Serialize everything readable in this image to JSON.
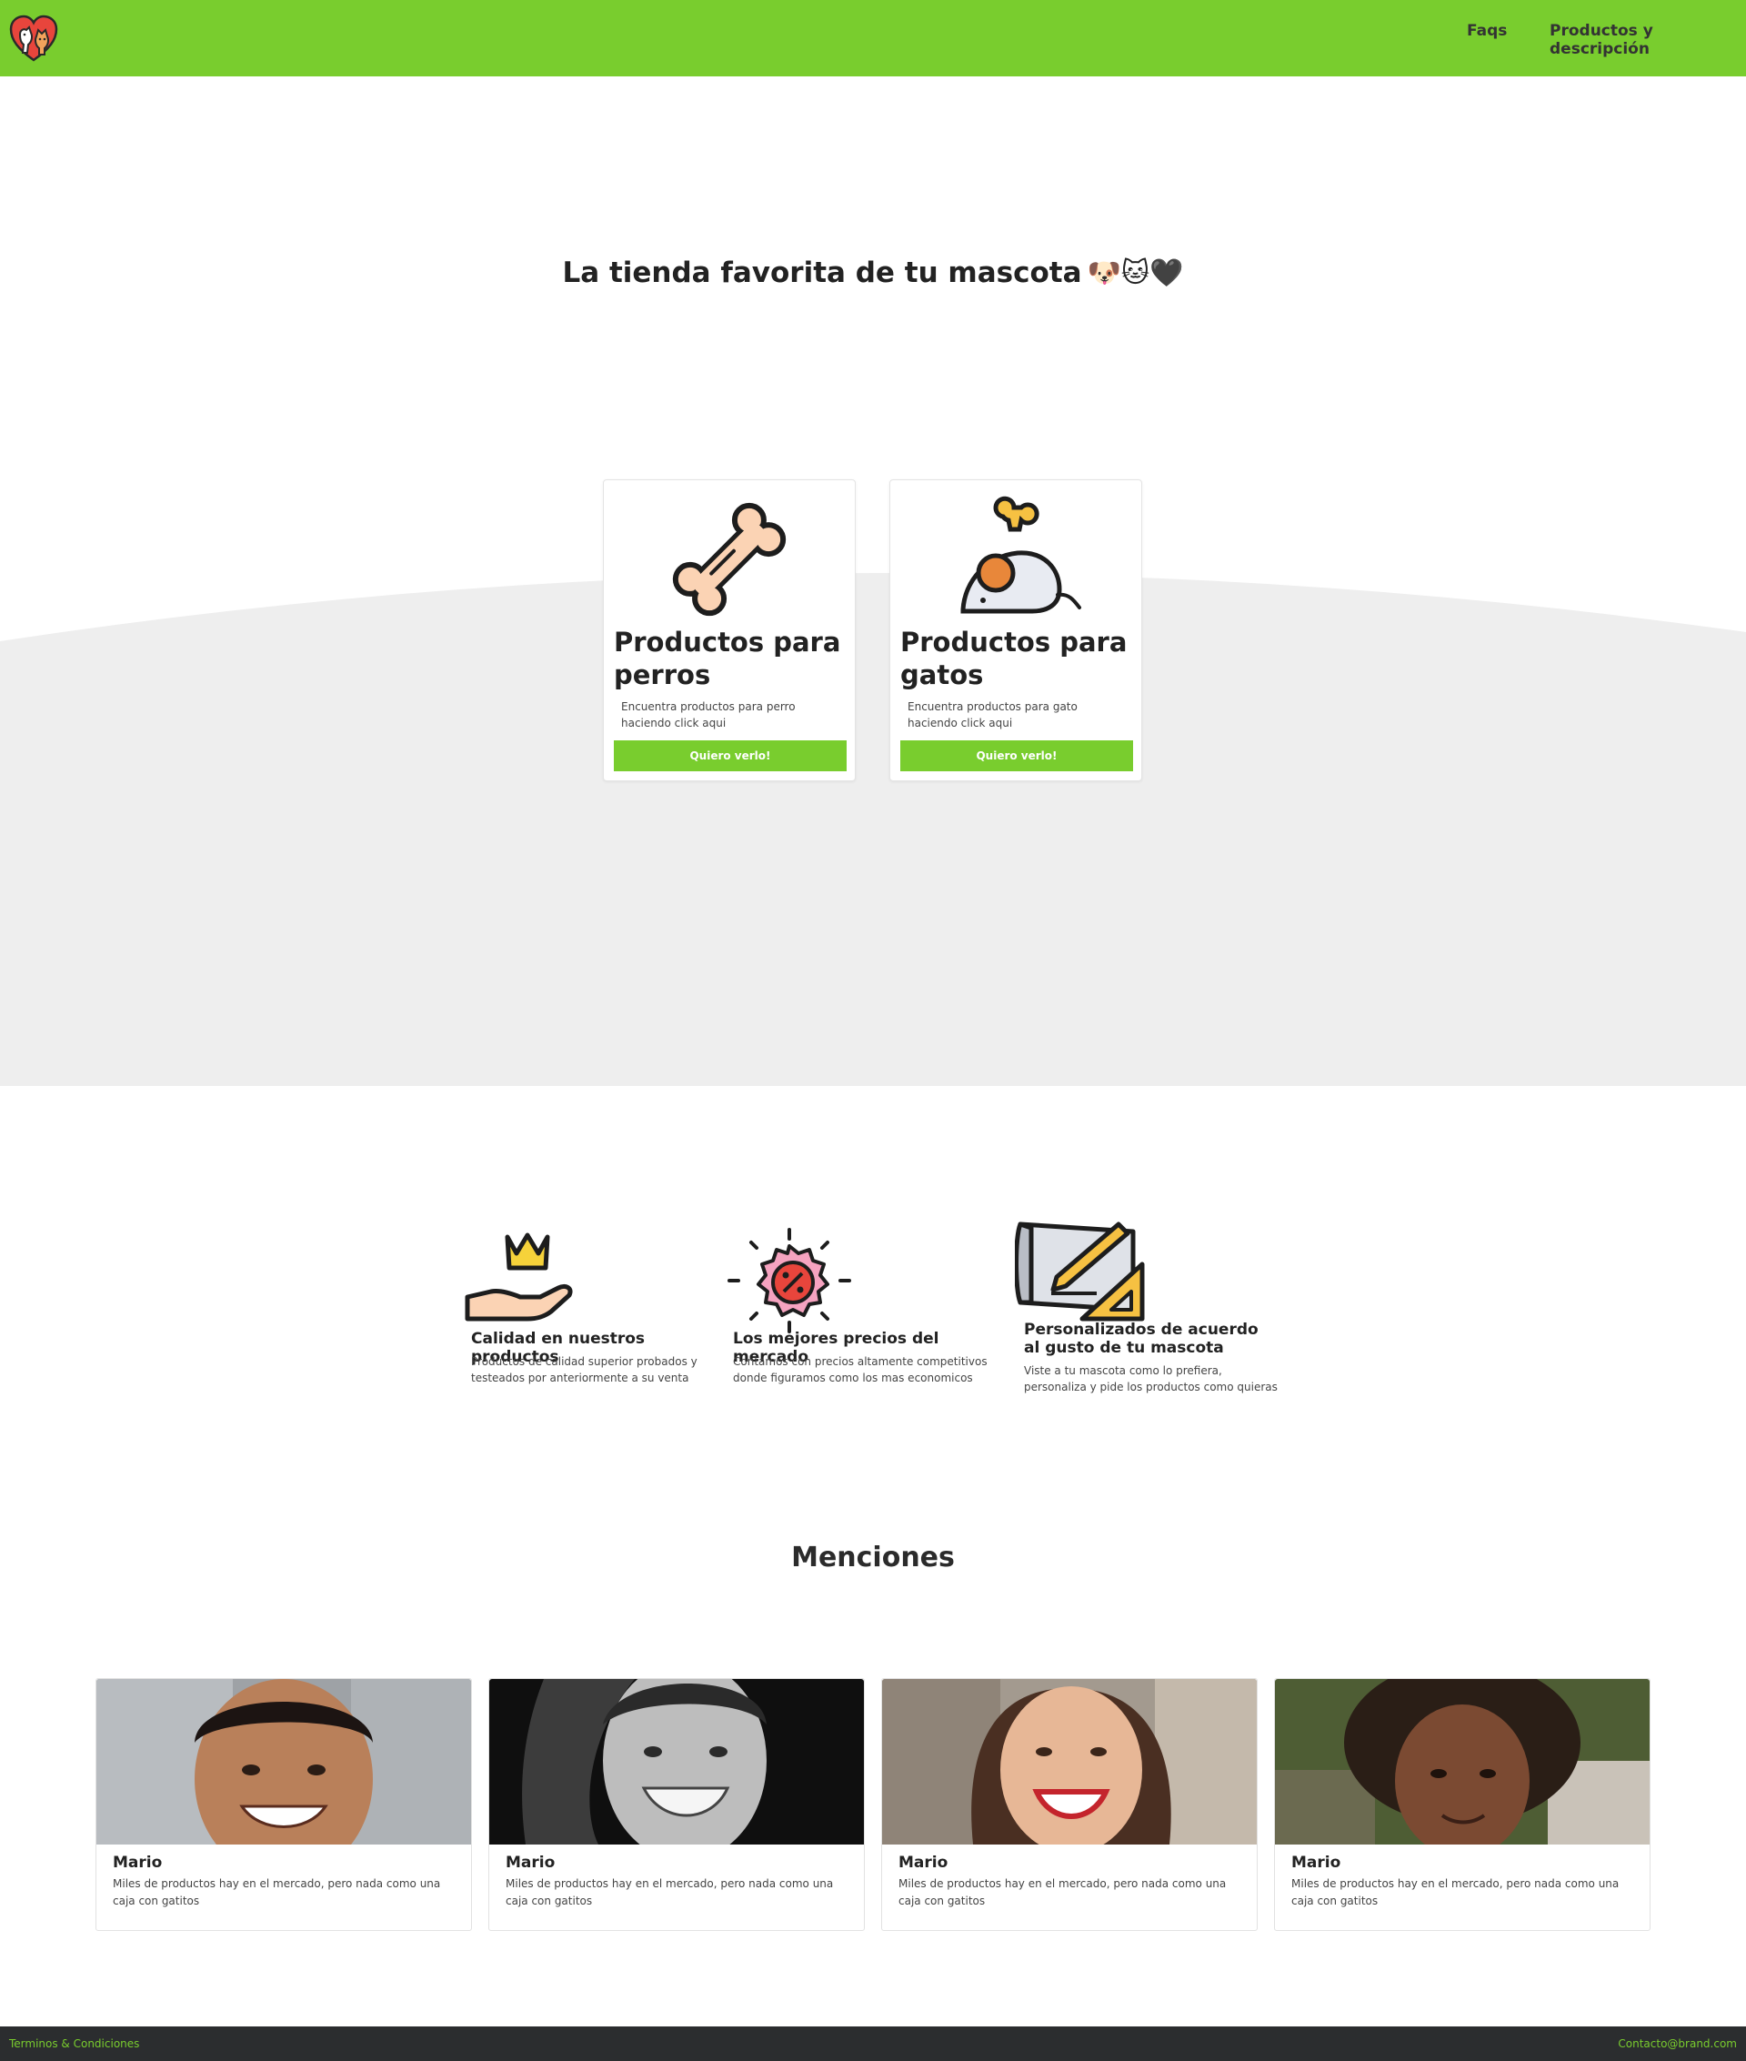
{
  "navbar": {
    "logo_icon": "heart-pets-logo-icon",
    "links": [
      {
        "label": "Faqs"
      },
      {
        "label": "Productos y descripción"
      }
    ]
  },
  "hero": {
    "title": "La tienda favorita de tu mascota",
    "emojis": "🐶🐱🖤"
  },
  "categories": [
    {
      "icon": "bone-icon",
      "title": "Productos para perros",
      "description": "Encuentra productos para perro haciendo click aqui",
      "button": "Quiero verlo!"
    },
    {
      "icon": "toy-mouse-icon",
      "title": "Productos para gatos",
      "description": "Encuentra productos para gato haciendo click aqui",
      "button": "Quiero verlo!"
    }
  ],
  "features": [
    {
      "icon": "crown-hand-icon",
      "title": "Calidad en nuestros productos",
      "description": "Productos de calidad superior probados y testeados por anteriormente a su venta"
    },
    {
      "icon": "discount-badge-icon",
      "title": "Los mejores precios del mercado",
      "description": "Contamos con precios altamente competitivos donde figuramos como los mas economicos"
    },
    {
      "icon": "design-pencil-ruler-icon",
      "title": "Personalizados de acuerdo al gusto de tu mascota",
      "description": "Viste a tu mascota como lo prefiera, personaliza y pide los productos como quieras"
    }
  ],
  "mentions": {
    "title": "Menciones",
    "items": [
      {
        "name": "Mario",
        "quote": "Miles de productos hay en el mercado, pero nada como una caja con gatitos"
      },
      {
        "name": "Mario",
        "quote": "Miles de productos hay en el mercado, pero nada como una caja con gatitos"
      },
      {
        "name": "Mario",
        "quote": "Miles de productos hay en el mercado, pero nada como una caja con gatitos"
      },
      {
        "name": "Mario",
        "quote": "Miles de productos hay en el mercado, pero nada como una caja con gatitos"
      }
    ]
  },
  "footer": {
    "terms": "Terminos & Condiciones",
    "contact": "Contacto@brand.com"
  },
  "colors": {
    "brand_green": "#79cd2e",
    "wave_gray": "#eeeeee",
    "footer_dark": "#2b2d2f"
  }
}
